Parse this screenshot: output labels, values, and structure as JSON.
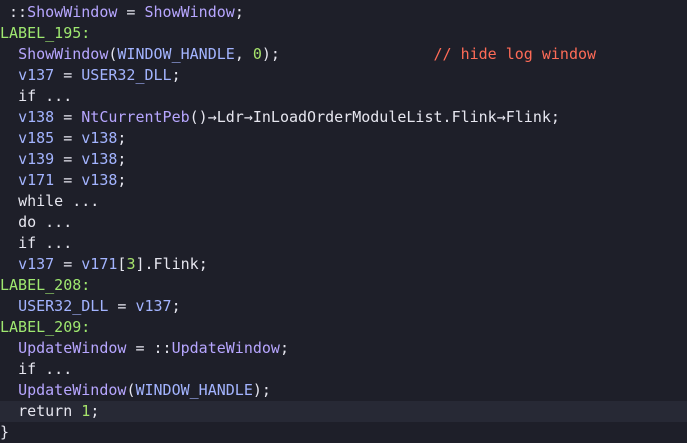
{
  "code_lines": [
    {
      "t": [
        " ::",
        "ShowWindow",
        " = ",
        "ShowWindow",
        ";"
      ]
    },
    {
      "t": [
        "LABEL_195",
        ":"
      ]
    },
    {
      "t": [
        "  ",
        "ShowWindow",
        "(",
        "WINDOW_HANDLE",
        ", ",
        "0",
        ");",
        "                 ",
        "// hide log window"
      ]
    },
    {
      "t": [
        "  ",
        "v137",
        " = ",
        "USER32_DLL",
        ";"
      ]
    },
    {
      "t": [
        "  ",
        "if",
        " ..."
      ]
    },
    {
      "t": [
        "  ",
        "v138",
        " = ",
        "NtCurrentPeb",
        "()→",
        "Ldr",
        "→",
        "InLoadOrderModuleList",
        ".",
        "Flink",
        "→",
        "Flink",
        ";"
      ]
    },
    {
      "t": [
        "  ",
        "v185",
        " = ",
        "v138",
        ";"
      ]
    },
    {
      "t": [
        "  ",
        "v139",
        " = ",
        "v138",
        ";"
      ]
    },
    {
      "t": [
        "  ",
        "v171",
        " = ",
        "v138",
        ";"
      ]
    },
    {
      "t": [
        "  ",
        "while",
        " ..."
      ]
    },
    {
      "t": [
        "  ",
        "do",
        " ..."
      ]
    },
    {
      "t": [
        "  ",
        "if",
        " ..."
      ]
    },
    {
      "t": [
        "  ",
        "v137",
        " = ",
        "v171",
        "[",
        "3",
        "].",
        "Flink",
        ";"
      ]
    },
    {
      "t": [
        "LABEL_208",
        ":"
      ]
    },
    {
      "t": [
        "  ",
        "USER32_DLL",
        " = ",
        "v137",
        ";"
      ]
    },
    {
      "t": [
        "LABEL_209",
        ":"
      ]
    },
    {
      "t": [
        "  ",
        "UpdateWindow",
        " = ",
        "::",
        "UpdateWindow",
        ";"
      ]
    },
    {
      "t": [
        "  ",
        "if",
        " ..."
      ]
    },
    {
      "t": [
        "  ",
        "UpdateWindow",
        "(",
        "WINDOW_HANDLE",
        ");"
      ]
    },
    {
      "t": [
        "  ",
        "return",
        " ",
        "1",
        ";"
      ]
    },
    {
      "t": [
        "}"
      ]
    }
  ],
  "colors": {
    "background": "#1e1f29",
    "label": "#9fe870",
    "function": "#b7a6ff",
    "variable": "#a3b4ff",
    "number": "#a6e36b",
    "comment": "#ff6b57",
    "current_line": "#272935"
  }
}
